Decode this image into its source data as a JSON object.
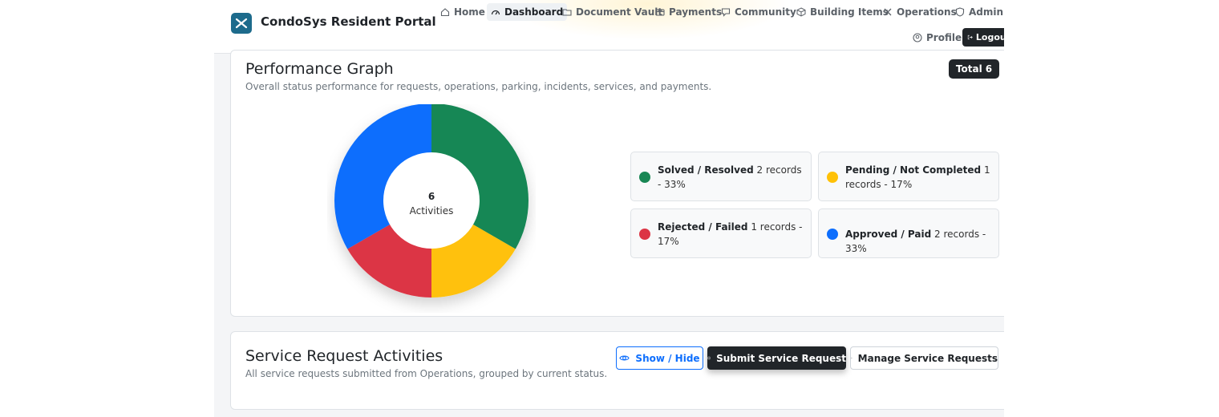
{
  "app": {
    "title": "CondoSys Resident Portal"
  },
  "nav": {
    "items": [
      {
        "label": "Home",
        "icon": "home-icon"
      },
      {
        "label": "Dashboard",
        "icon": "dashboard-icon"
      },
      {
        "label": "Document Vault",
        "icon": "folder-icon"
      },
      {
        "label": "Payments",
        "icon": "wallet-icon"
      },
      {
        "label": "Community",
        "icon": "chat-icon"
      },
      {
        "label": "Building Items",
        "icon": "box-icon"
      },
      {
        "label": "Operations",
        "icon": "tools-icon"
      },
      {
        "label": "Admin",
        "icon": "shield-icon"
      }
    ],
    "profile": "Profile",
    "logout": "Logout",
    "active": "Dashboard"
  },
  "performance": {
    "title": "Performance Graph",
    "subtitle": "Overall status performance for requests, operations, parking, incidents, services, and payments.",
    "total_label": "Total",
    "total_value": "6",
    "center_value": "6",
    "center_label": "Activities",
    "legend": [
      {
        "name": "Solved / Resolved",
        "detail": "2 records - 33%",
        "color": "#198754"
      },
      {
        "name": "Pending / Not Completed",
        "detail": "1 records - 17%",
        "color": "#ffc107"
      },
      {
        "name": "Rejected / Failed",
        "detail": "1 records - 17%",
        "color": "#dc3545"
      },
      {
        "name": "Approved / Paid",
        "detail": "2 records - 33%",
        "color": "#0d6efd"
      }
    ]
  },
  "chart_data": {
    "type": "pie",
    "categories": [
      "Solved / Resolved",
      "Pending / Not Completed",
      "Rejected / Failed",
      "Approved / Paid"
    ],
    "values": [
      2,
      1,
      1,
      2
    ],
    "colors": [
      "#198754",
      "#ffc107",
      "#dc3545",
      "#0d6efd"
    ]
  },
  "service": {
    "title": "Service Request Activities",
    "subtitle": "All service requests submitted from Operations, grouped by current status.",
    "show_hide": "Show / Hide",
    "submit": "Submit Service Request",
    "manage": "Manage Service Requests"
  }
}
